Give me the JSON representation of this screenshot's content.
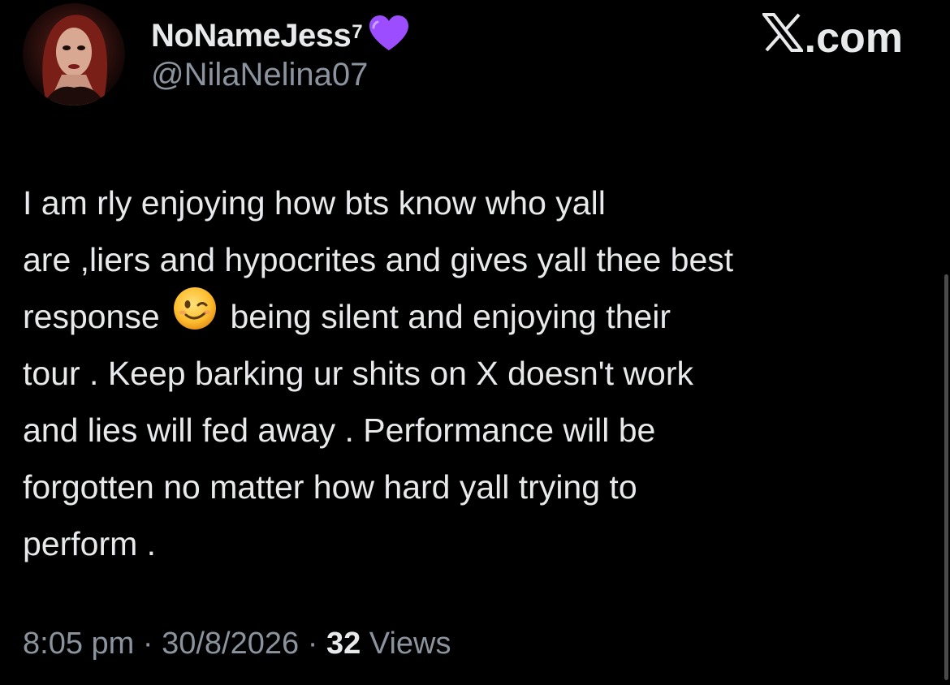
{
  "user": {
    "display_name": "NoNameJess",
    "display_name_sup": "7",
    "badge_icon": "purple-heart-icon",
    "handle": "@NilaNelina07"
  },
  "brand": {
    "label": ".com",
    "icon": "x-logo-icon"
  },
  "tweet": {
    "lines": [
      "I am rly enjoying how bts know who yall",
      "are ,liers and hypocrites and gives yall thee best",
      "response",
      "being silent and enjoying their",
      "tour . Keep barking ur shits on X doesn't work",
      "and lies will fed away . Performance will be",
      "forgotten no matter how hard yall trying to",
      "perform ."
    ],
    "emoji": "winking-face-icon"
  },
  "meta": {
    "time": "8:05 pm",
    "date": "30/8/2026",
    "separator": "·",
    "views_count": "32",
    "views_label": "Views"
  },
  "colors": {
    "background": "#000000",
    "text_primary": "#e7e9ea",
    "text_secondary": "#8b949e",
    "heart": "#9b4dff"
  }
}
